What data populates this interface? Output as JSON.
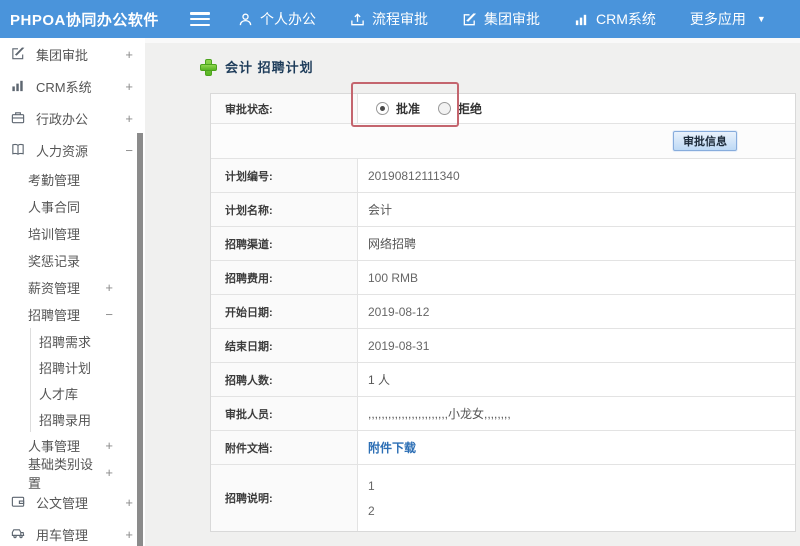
{
  "topbar": {
    "logo": "PHPOA协同办公软件",
    "nav": [
      {
        "label": "个人办公",
        "icon": "person-icon"
      },
      {
        "label": "流程审批",
        "icon": "upload-icon"
      },
      {
        "label": "集团审批",
        "icon": "edit-icon"
      },
      {
        "label": "CRM系统",
        "icon": "chart-icon"
      },
      {
        "label": "更多应用",
        "icon": "caret-down-icon"
      }
    ],
    "caret": "▼"
  },
  "sidebar": {
    "items": [
      {
        "label": "集团审批",
        "expand": "+"
      },
      {
        "label": "CRM系统",
        "expand": "+"
      },
      {
        "label": "行政办公",
        "expand": "+"
      },
      {
        "label": "人力资源",
        "expand": "−",
        "children": [
          {
            "label": "考勤管理"
          },
          {
            "label": "人事合同"
          },
          {
            "label": "培训管理"
          },
          {
            "label": "奖惩记录"
          },
          {
            "label": "薪资管理",
            "expand": "+"
          },
          {
            "label": "招聘管理",
            "expand": "−",
            "children": [
              {
                "label": "招聘需求"
              },
              {
                "label": "招聘计划"
              },
              {
                "label": "人才库"
              },
              {
                "label": "招聘录用"
              }
            ]
          },
          {
            "label": "人事管理",
            "expand": "+"
          },
          {
            "label": "基础类别设置",
            "expand": "+"
          }
        ]
      },
      {
        "label": "公文管理",
        "expand": "+"
      },
      {
        "label": "用车管理",
        "expand": "+"
      }
    ]
  },
  "main": {
    "title": "会计 招聘计划",
    "approval_label": "审批状态:",
    "approval_options": [
      {
        "label": "批准",
        "selected": true
      },
      {
        "label": "拒绝",
        "selected": false
      }
    ],
    "approve_button": "审批信息",
    "fields": [
      {
        "label": "计划编号:",
        "value": "20190812111340"
      },
      {
        "label": "计划名称:",
        "value": "会计"
      },
      {
        "label": "招聘渠道:",
        "value": "网络招聘"
      },
      {
        "label": "招聘费用:",
        "value": "100 RMB"
      },
      {
        "label": "开始日期:",
        "value": "2019-08-12"
      },
      {
        "label": "结束日期:",
        "value": "2019-08-31"
      },
      {
        "label": "招聘人数:",
        "value": "1 人"
      },
      {
        "label": "审批人员:",
        "value": ",,,,,,,,,,,,,,,,,,,,,,,,小龙女,,,,,,,,"
      },
      {
        "label": "附件文档:",
        "value": "附件下载"
      }
    ],
    "description": {
      "label": "招聘说明:",
      "lines": [
        "1",
        "2"
      ]
    }
  }
}
